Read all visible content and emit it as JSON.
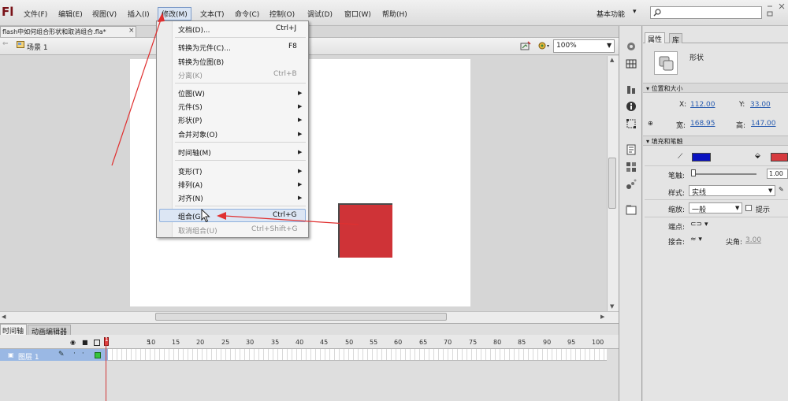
{
  "app": {
    "logo": "Fl",
    "workspace": "基本功能"
  },
  "menubar": {
    "items": [
      "文件(F)",
      "编辑(E)",
      "视图(V)",
      "插入(I)",
      "修改(M)",
      "文本(T)",
      "命令(C)",
      "控制(O)",
      "调试(D)",
      "窗口(W)",
      "帮助(H)"
    ],
    "active": "修改(M)"
  },
  "document": {
    "tab_title": "flash中如何组合形状和取消组合.fla*",
    "close": "×"
  },
  "editbar": {
    "scene": "场景 1",
    "zoom": "100%"
  },
  "dropdown": {
    "items": [
      {
        "label": "文档(D)...",
        "shortcut": "Ctrl+J",
        "submenu": false,
        "enabled": true
      },
      {
        "label": "转换为元件(C)...",
        "shortcut": "F8",
        "submenu": false,
        "enabled": true
      },
      {
        "label": "转换为位图(B)",
        "shortcut": "",
        "submenu": false,
        "enabled": true
      },
      {
        "label": "分离(K)",
        "shortcut": "Ctrl+B",
        "submenu": false,
        "enabled": false
      },
      {
        "label": "位图(W)",
        "shortcut": "",
        "submenu": true,
        "enabled": true
      },
      {
        "label": "元件(S)",
        "shortcut": "",
        "submenu": true,
        "enabled": true
      },
      {
        "label": "形状(P)",
        "shortcut": "",
        "submenu": true,
        "enabled": true
      },
      {
        "label": "合并对象(O)",
        "shortcut": "",
        "submenu": true,
        "enabled": true
      },
      {
        "label": "时间轴(M)",
        "shortcut": "",
        "submenu": true,
        "enabled": true
      },
      {
        "label": "变形(T)",
        "shortcut": "",
        "submenu": true,
        "enabled": true
      },
      {
        "label": "排列(A)",
        "shortcut": "",
        "submenu": true,
        "enabled": true
      },
      {
        "label": "对齐(N)",
        "shortcut": "",
        "submenu": true,
        "enabled": true
      },
      {
        "label": "组合(G)",
        "shortcut": "Ctrl+G",
        "submenu": false,
        "enabled": true,
        "highlighted": true
      },
      {
        "label": "取消组合(U)",
        "shortcut": "Ctrl+Shift+G",
        "submenu": false,
        "enabled": false
      }
    ]
  },
  "timeline": {
    "tabs": [
      "时间轴",
      "动画编辑器"
    ],
    "layer_name": "图层 1",
    "frame_ticks": [
      "1",
      "5",
      "10",
      "15",
      "20",
      "25",
      "30",
      "35",
      "40",
      "45",
      "50",
      "55",
      "60",
      "65",
      "70",
      "75",
      "80",
      "85",
      "90",
      "95",
      "100"
    ]
  },
  "properties": {
    "tabs": [
      "属性",
      "库"
    ],
    "object_type": "形状",
    "position_size": {
      "section": "位置和大小",
      "x_label": "X:",
      "x": "112.00",
      "y_label": "Y:",
      "y": "33.00",
      "w_label": "宽:",
      "w": "168.95",
      "h_label": "高:",
      "h": "147.00"
    },
    "fill_stroke": {
      "section": "填充和笔触",
      "stroke_color": "#0a12c0",
      "fill_color": "#d63a3e",
      "stroke_label": "笔触:",
      "stroke_value": "1.00",
      "style_label": "样式:",
      "style_value": "实线",
      "scale_label": "缩放:",
      "scale_value": "一般",
      "hint_label": "提示",
      "cap_label": "端点:",
      "join_label": "接合:",
      "miter_label": "尖角:",
      "miter_value": "3.00"
    }
  },
  "stage": {
    "shape_color": "#cf3337",
    "annotation_color": "#e03030"
  }
}
